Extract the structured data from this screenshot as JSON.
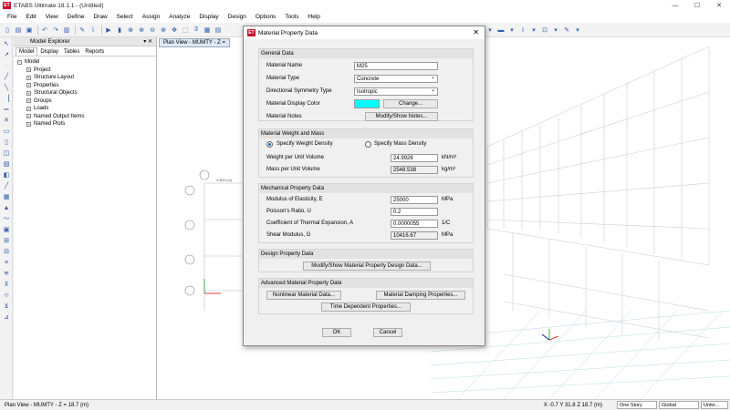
{
  "app": {
    "title": "ETABS Ultimate 18.1.1 - (Untitled)",
    "logo": "ET"
  },
  "menu": [
    "File",
    "Edit",
    "View",
    "Define",
    "Draw",
    "Select",
    "Assign",
    "Analyze",
    "Display",
    "Design",
    "Options",
    "Tools",
    "Help"
  ],
  "explorer": {
    "title": "Model Explorer",
    "tabs": [
      "Model",
      "Display",
      "Tables",
      "Reports"
    ],
    "root": "Model",
    "items": [
      "Project",
      "Structure Layout",
      "Properties",
      "Structural Objects",
      "Groups",
      "Loads",
      "Named Output Items",
      "Named Plots"
    ]
  },
  "viewport": {
    "tab_label": "Plan View - MUMTY - Z ="
  },
  "dialog": {
    "title": "Material Property Data",
    "general": {
      "title": "General Data",
      "name_label": "Material Name",
      "name_value": "M25",
      "type_label": "Material Type",
      "type_value": "Concrete",
      "symmetry_label": "Directional Symmetry Type",
      "symmetry_value": "Isotropic",
      "color_label": "Material Display Color",
      "color_button": "Change...",
      "notes_label": "Material Notes",
      "notes_button": "Modify/Show Notes...",
      "display_color": "#00ffff"
    },
    "weight": {
      "title": "Material Weight and Mass",
      "radio1": "Specify Weight Density",
      "radio2": "Specify Mass Density",
      "wpuv_label": "Weight per Unit Volume",
      "wpuv_value": "24.9926",
      "wpuv_unit": "kN/m³",
      "mpuv_label": "Mass per Unit Volume",
      "mpuv_value": "2548.538",
      "mpuv_unit": "kg/m³"
    },
    "mechanical": {
      "title": "Mechanical Property Data",
      "e_label": "Modulus of Elasticity,  E",
      "e_value": "25000",
      "e_unit": "MPa",
      "u_label": "Poisson's Ratio,  U",
      "u_value": "0.2",
      "a_label": "Coefficient of Thermal Expansion,  A",
      "a_value": "0.0000055",
      "a_unit": "1/C",
      "g_label": "Shear Modulus,  G",
      "g_value": "10416.67",
      "g_unit": "MPa"
    },
    "design": {
      "title": "Design Property Data",
      "button": "Modify/Show Material Property Design Data..."
    },
    "advanced": {
      "title": "Advanced Material Property Data",
      "nonlinear": "Nonlinear Material Data...",
      "damping": "Material Damping Properties...",
      "time": "Time Dependent Properties..."
    },
    "ok": "OK",
    "cancel": "Cancel"
  },
  "status": {
    "left": "Plan View - MUMTY - Z = 18.7 (m)",
    "coords": "X -0.7  Y 31.8  Z 18.7 (m)",
    "story": "One Story",
    "coord_sys": "Global",
    "units": "Units..."
  },
  "plan": {
    "dim": "4.800 (m)"
  }
}
